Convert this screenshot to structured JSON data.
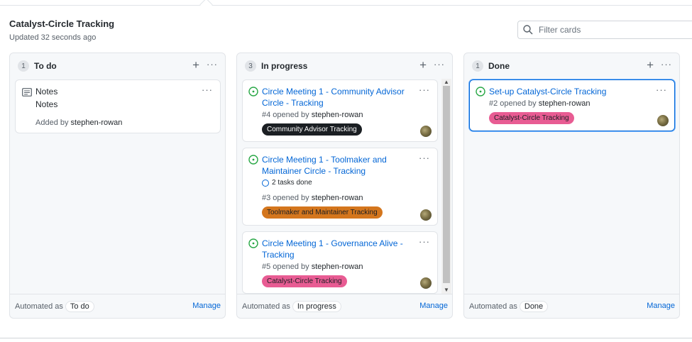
{
  "project": {
    "title": "Catalyst-Circle Tracking",
    "updated": "Updated 32 seconds ago"
  },
  "filter": {
    "placeholder": "Filter cards",
    "icon": "search-icon"
  },
  "columns": [
    {
      "count": "1",
      "name": "To do",
      "automated_as_label": "Automated as",
      "automated_as": "To do",
      "manage": "Manage",
      "cards": [
        {
          "type": "note",
          "title": "Notes",
          "body": "Notes",
          "added_by_label": "Added by",
          "added_by": "stephen-rowan"
        }
      ]
    },
    {
      "count": "3",
      "name": "In progress",
      "automated_as_label": "Automated as",
      "automated_as": "In progress",
      "manage": "Manage",
      "cards": [
        {
          "type": "issue",
          "title": "Circle Meeting 1 - Community Advisor Circle - Tracking",
          "meta_prefix": "#4 opened by",
          "author": "stephen-rowan",
          "label": "Community Advisor Tracking",
          "label_color": "#1b1f23",
          "label_text_color": "#ffffff"
        },
        {
          "type": "issue",
          "title": "Circle Meeting 1 - Toolmaker and Maintainer Circle - Tracking",
          "tasks": "2 tasks done",
          "meta_prefix": "#3 opened by",
          "author": "stephen-rowan",
          "label": "Toolmaker and Maintainer Tracking",
          "label_color": "#d4761d",
          "label_text_color": "#1b1f23"
        },
        {
          "type": "issue",
          "title": "Circle Meeting 1 - Governance Alive - Tracking",
          "meta_prefix": "#5 opened by",
          "author": "stephen-rowan",
          "label": "Catalyst-Circle Tracking",
          "label_color": "#e85c93",
          "label_text_color": "#1b1f23"
        }
      ]
    },
    {
      "count": "1",
      "name": "Done",
      "automated_as_label": "Automated as",
      "automated_as": "Done",
      "manage": "Manage",
      "cards": [
        {
          "type": "issue",
          "title": "Set-up Catalyst-Circle Tracking",
          "meta_prefix": "#2 opened by",
          "author": "stephen-rowan",
          "label": "Catalyst-Circle Tracking",
          "label_color": "#e85c93",
          "label_text_color": "#1b1f23"
        }
      ]
    }
  ],
  "colors": {
    "link": "#0366d6",
    "open_issue": "#28a745",
    "column_bg": "#f6f8fa"
  }
}
